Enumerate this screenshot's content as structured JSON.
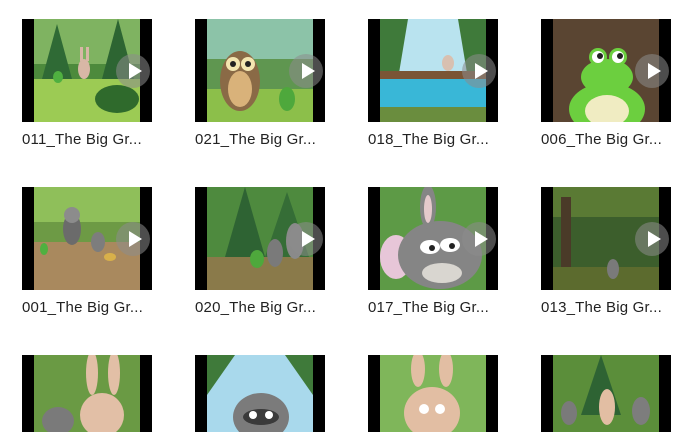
{
  "files": [
    {
      "name": "011_The Big Gr...",
      "scene": "forest-rabbit-frog"
    },
    {
      "name": "021_The Big Gr...",
      "scene": "owl-frog"
    },
    {
      "name": "018_The Big Gr...",
      "scene": "river-log-rabbit"
    },
    {
      "name": "006_The Big Gr...",
      "scene": "frog-closeup"
    },
    {
      "name": "001_The Big Gr...",
      "scene": "raccoon-squirrel-path"
    },
    {
      "name": "020_The Big Gr...",
      "scene": "frog-raccoon-group"
    },
    {
      "name": "017_The Big Gr...",
      "scene": "rabbit-face"
    },
    {
      "name": "013_The Big Gr...",
      "scene": "dark-forest-raccoon"
    },
    {
      "name": "",
      "scene": "raccoon-rabbit"
    },
    {
      "name": "",
      "scene": "raccoon-face"
    },
    {
      "name": "",
      "scene": "rabbit-portrait"
    },
    {
      "name": "",
      "scene": "animal-group"
    }
  ],
  "icons": {
    "play": "play-icon"
  },
  "colors": {
    "caption": "#222222",
    "thumb_bar": "#000000",
    "grass": "#8cbf4a",
    "forest": "#3f7a3a",
    "sky": "#b9e3ef"
  }
}
